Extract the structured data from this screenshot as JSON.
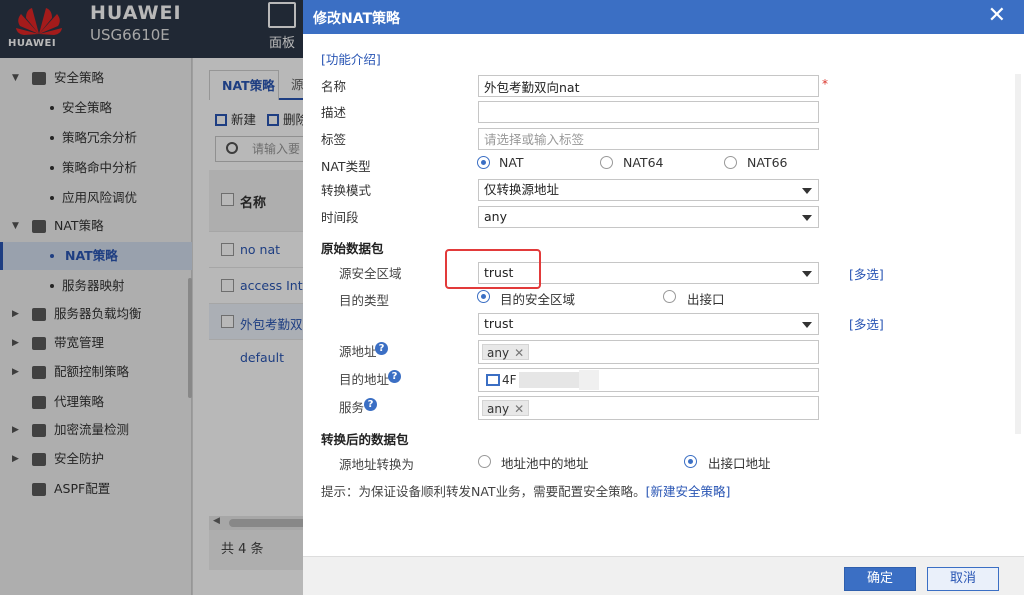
{
  "app": {
    "brand": "HUAWEI",
    "logo_text": "HUAWEI",
    "model": "USG6610E",
    "panel_label": "面板"
  },
  "sidebar": {
    "items": [
      {
        "label": "安全策略",
        "level": "parent",
        "expanded": true
      },
      {
        "label": "安全策略",
        "level": "child"
      },
      {
        "label": "策略冗余分析",
        "level": "child"
      },
      {
        "label": "策略命中分析",
        "level": "child"
      },
      {
        "label": "应用风险调优",
        "level": "child"
      },
      {
        "label": "NAT策略",
        "level": "parent",
        "expanded": true
      },
      {
        "label": "NAT策略",
        "level": "child",
        "active": true
      },
      {
        "label": "服务器映射",
        "level": "child"
      },
      {
        "label": "服务器负载均衡",
        "level": "parent",
        "expanded": false
      },
      {
        "label": "带宽管理",
        "level": "parent",
        "expanded": false
      },
      {
        "label": "配额控制策略",
        "level": "parent",
        "expanded": false
      },
      {
        "label": "代理策略",
        "level": "parent",
        "expanded": false
      },
      {
        "label": "加密流量检测",
        "level": "parent",
        "expanded": false
      },
      {
        "label": "安全防护",
        "level": "parent",
        "expanded": false
      },
      {
        "label": "ASPF配置",
        "level": "parent",
        "expanded": false
      }
    ]
  },
  "content": {
    "tabs": [
      {
        "label": "NAT策略",
        "active": true
      },
      {
        "label": "源",
        "active": false
      }
    ],
    "toolbar": {
      "new_label": "新建",
      "delete_label": "删除"
    },
    "search_placeholder": "请输入要",
    "grid": {
      "header": "名称",
      "rows": [
        "no nat",
        "access Inte",
        "外包考勤双",
        "default"
      ]
    },
    "total": "共 4 条"
  },
  "dialog": {
    "title": "修改NAT策略",
    "close_glyph": "✕",
    "intro_link": "[功能介绍]",
    "name_label": "名称",
    "name_value": "外包考勤双向nat",
    "required_mark": "*",
    "desc_label": "描述",
    "desc_value": "",
    "tag_label": "标签",
    "tag_placeholder": "请选择或输入标签",
    "nat_type_label": "NAT类型",
    "nat_type_options": [
      {
        "label": "NAT",
        "checked": true
      },
      {
        "label": "NAT64",
        "checked": false
      },
      {
        "label": "NAT66",
        "checked": false
      }
    ],
    "mode_label": "转换模式",
    "mode_value": "仅转换源地址",
    "time_label": "时间段",
    "time_value": "any",
    "orig_section": "原始数据包",
    "src_zone_label": "源安全区域",
    "src_zone_value": "trust",
    "multi_link": "[多选]",
    "dst_type_label": "目的类型",
    "dst_type_options": [
      {
        "label": "目的安全区域",
        "checked": true
      },
      {
        "label": "出接口",
        "checked": false
      }
    ],
    "dst_zone_value": "trust",
    "src_addr_label": "源地址",
    "src_addr_chip": "any",
    "dst_addr_label": "目的地址",
    "dst_addr_chip": "4F",
    "service_label": "服务",
    "service_chip": "any",
    "help_glyph": "?",
    "remove_glyph": "✕",
    "trans_section": "转换后的数据包",
    "src_trans_label": "源地址转换为",
    "src_trans_options": [
      {
        "label": "地址池中的地址",
        "checked": false
      },
      {
        "label": "出接口地址",
        "checked": true
      }
    ],
    "tip_text": "提示：为保证设备顺利转发NAT业务，需要配置安全策略。",
    "tip_link": "[新建安全策略]",
    "ok_label": "确定",
    "cancel_label": "取消"
  },
  "colors": {
    "accent": "#3b6fc4",
    "topbar": "#2d3848",
    "highlight": "#e23a3a",
    "required": "#d9342b"
  }
}
